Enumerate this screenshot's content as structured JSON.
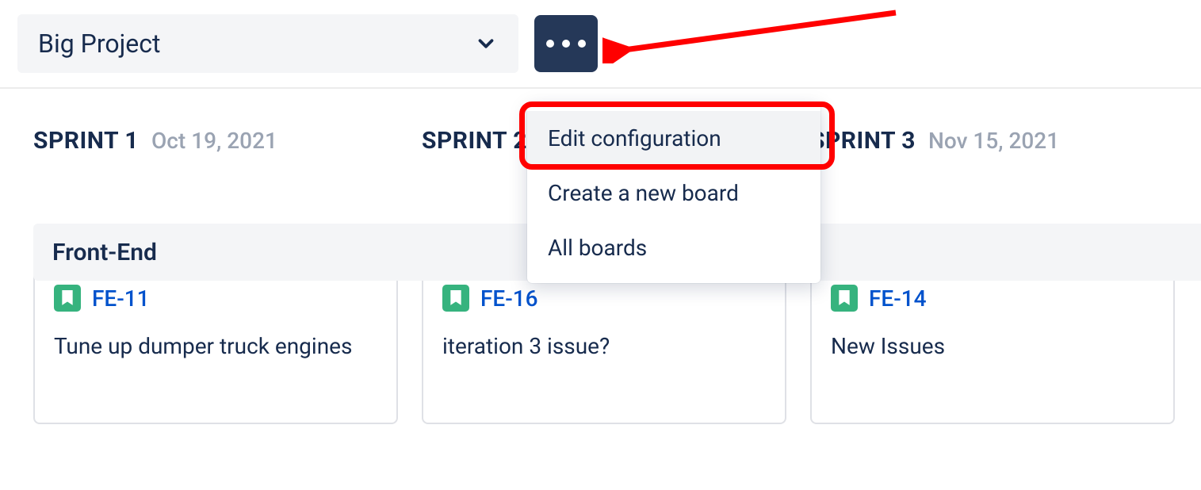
{
  "project_select": {
    "label": "Big Project"
  },
  "menu": {
    "items": [
      {
        "label": "Edit configuration"
      },
      {
        "label": "Create a new board"
      },
      {
        "label": "All boards"
      }
    ]
  },
  "group": {
    "label": "Front-End"
  },
  "sprints": [
    {
      "title": "SPRINT 1",
      "date": "Oct 19, 2021",
      "card": {
        "key": "FE-11",
        "summary": "Tune up dumper truck engines"
      }
    },
    {
      "title": "SPRINT 2",
      "date": "",
      "card": {
        "key": "FE-16",
        "summary": "iteration 3 issue?"
      }
    },
    {
      "title": "SPRINT 3",
      "date": "Nov 15, 2021",
      "card": {
        "key": "FE-14",
        "summary": "New Issues"
      }
    }
  ]
}
